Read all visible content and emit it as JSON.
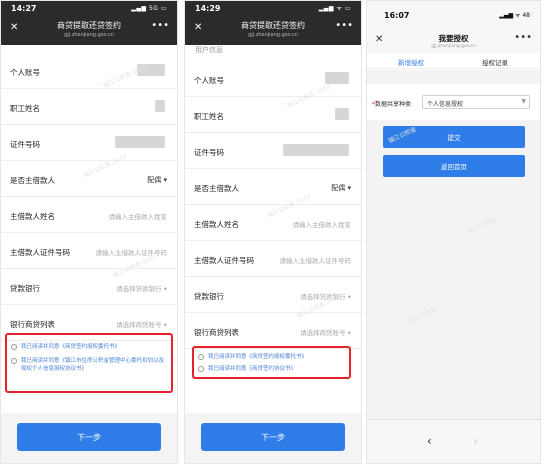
{
  "phone1": {
    "time": "14:27",
    "signal": "▂▄▆ 5G ▭",
    "title": "商贷提取还贷签约",
    "subtitle": "gjj.zhenjiang.gov.cn",
    "rows": [
      {
        "label": "个人账号",
        "value": ""
      },
      {
        "label": "职工姓名",
        "value": ""
      },
      {
        "label": "证件号码",
        "value": ""
      },
      {
        "label": "是否主借款人",
        "value": "配偶 ▾"
      },
      {
        "label": "主借款人姓名",
        "value": "请输入主借款人姓名"
      },
      {
        "label": "主借款人证件号码",
        "value": "请输入主借款人证件号码"
      },
      {
        "label": "贷款银行",
        "value": "请选择贷款银行 ▾"
      },
      {
        "label": "银行商贷列表",
        "value": "请选择商贷账号 ▾"
      }
    ],
    "agreements": [
      "我已阅读并同意《商贷签约授权委托书》",
      "我已阅读并同意《镇江市住房公积金管理中心委托扣划以及授权个人信息授权协议书》"
    ],
    "next_label": "下一步"
  },
  "phone2": {
    "time": "14:29",
    "signal": "▂▄▆ ᯤ ▭",
    "title": "商贷提取还贷签约",
    "subtitle": "gjj.zhenjiang.gov.cn",
    "top_partial": "用户信息",
    "rows": [
      {
        "label": "个人账号",
        "value": ""
      },
      {
        "label": "职工姓名",
        "value": ""
      },
      {
        "label": "证件号码",
        "value": ""
      },
      {
        "label": "是否主借款人",
        "value": "配偶 ▾"
      },
      {
        "label": "主借款人姓名",
        "value": "请输入主借款人姓名"
      },
      {
        "label": "主借款人证件号码",
        "value": "请输入主借款人证件号码"
      },
      {
        "label": "贷款银行",
        "value": "请选择贷款银行 ▾"
      },
      {
        "label": "银行商贷列表",
        "value": "请选择商贷账号 ▾"
      }
    ],
    "agreements": [
      "我已阅读并同意《商贷签约授权委托书》",
      "我已阅读并同意《商贷签约协议书》"
    ],
    "next_label": "下一步"
  },
  "phone3": {
    "time": "16:07",
    "signal": "▂▄▆ ᯤ 48",
    "title": "我要授权",
    "subtitle": "gjj.zhenjiang.gov.cn",
    "tabs": [
      "新增授权",
      "授权记录"
    ],
    "field_label": "数据共享种类",
    "field_value": "个人信息授权",
    "submit_label": "提交",
    "home_label": "返回首页",
    "nav_back": "‹",
    "nav_forward": "›"
  },
  "colors": {
    "primary": "#2f7de9",
    "highlight": "#e8222c",
    "header_dark": "#2b2b2b"
  }
}
